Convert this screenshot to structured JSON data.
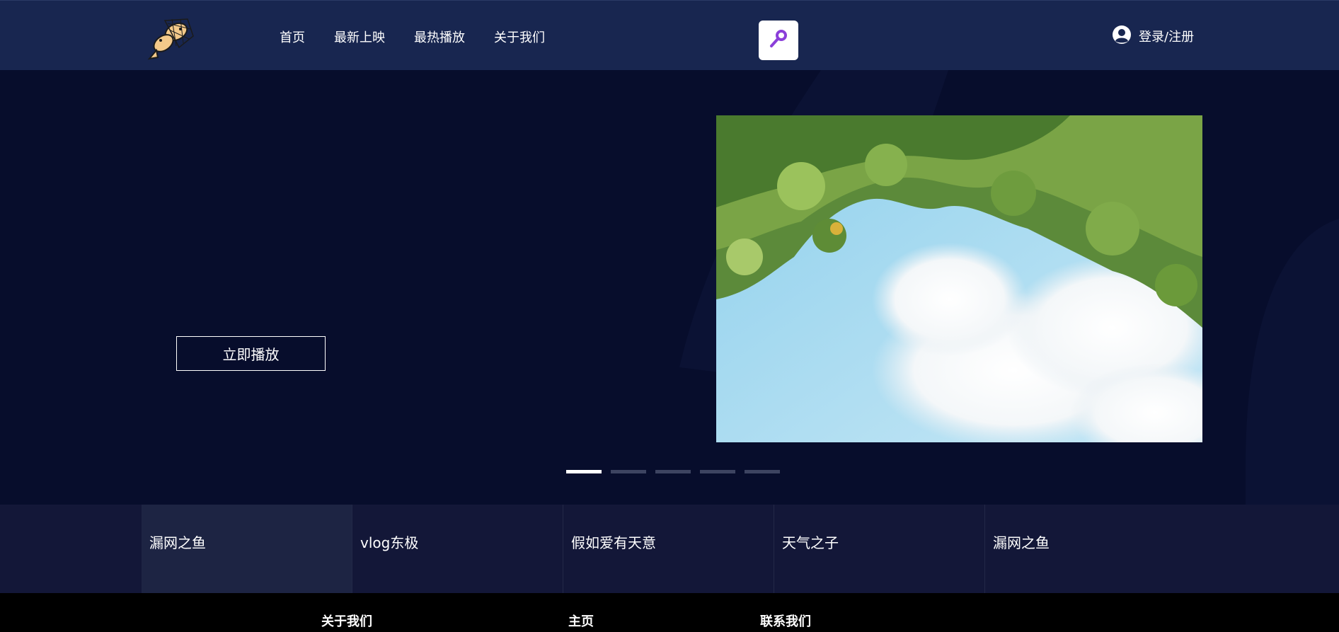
{
  "header": {
    "logo_icon": "fish-net-logo",
    "nav": [
      {
        "label": "首页"
      },
      {
        "label": "最新上映"
      },
      {
        "label": "最热播放"
      },
      {
        "label": "关于我们"
      }
    ],
    "search_icon": "search-icon",
    "login": {
      "icon": "user-icon",
      "label": "登录/注册"
    }
  },
  "hero": {
    "play_label": "立即播放",
    "image": "leaves-and-sky",
    "slides_total": 5,
    "active_slide": 1
  },
  "tabs": [
    {
      "label": "漏网之鱼"
    },
    {
      "label": "vlog东极"
    },
    {
      "label": "假如爱有天意"
    },
    {
      "label": "天气之子"
    },
    {
      "label": "漏网之鱼"
    }
  ],
  "footer": {
    "links": [
      {
        "label": "关于我们"
      },
      {
        "label": "主页"
      },
      {
        "label": "联系我们"
      }
    ]
  },
  "colors": {
    "header_bg": "#182650",
    "hero_bg": "#070d2c",
    "tabs_bg": "#131738",
    "accent": "#8b3fd9"
  }
}
